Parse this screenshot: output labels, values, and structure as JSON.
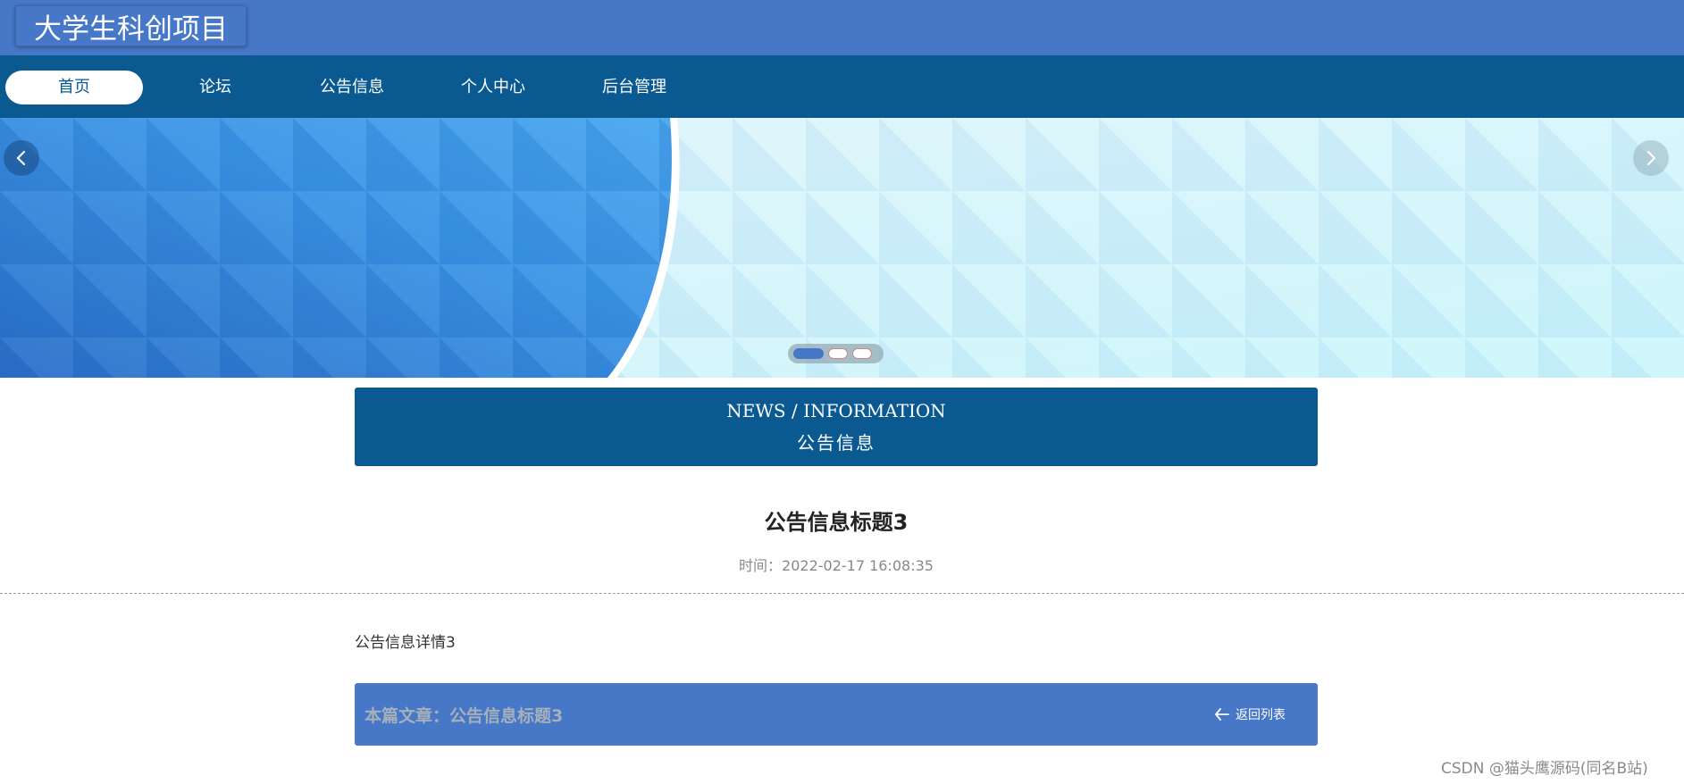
{
  "header": {
    "site_title": "大学生科创项目"
  },
  "nav": {
    "items": [
      {
        "label": "首页",
        "active": true
      },
      {
        "label": "论坛",
        "active": false
      },
      {
        "label": "公告信息",
        "active": false
      },
      {
        "label": "个人中心",
        "active": false
      },
      {
        "label": "后台管理",
        "active": false
      }
    ]
  },
  "banner": {
    "slides_count": 3,
    "active_slide": 1
  },
  "section": {
    "title_en": "NEWS / INFORMATION",
    "title_cn": "公告信息"
  },
  "article": {
    "title": "公告信息标题3",
    "time": "时间：2022-02-17 16:08:35",
    "content": "公告信息详情3"
  },
  "footer": {
    "current_article": "本篇文章：公告信息标题3",
    "back_label": "返回列表"
  },
  "watermark": "CSDN @猫头鹰源码(同名B站)",
  "colors": {
    "primary": "#4777c7",
    "nav": "#0a5a91",
    "white": "#ffffff"
  },
  "icons": {
    "prev": "chevron-left-icon",
    "next": "chevron-right-icon",
    "back": "arrow-left-icon"
  }
}
